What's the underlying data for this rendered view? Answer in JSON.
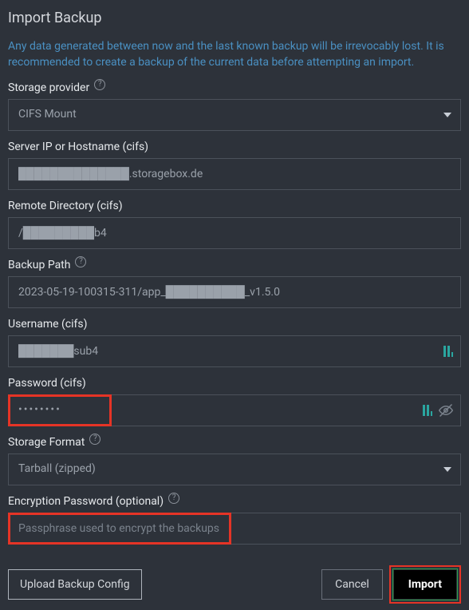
{
  "title": "Import Backup",
  "warning": "Any data generated between now and the last known backup will be irrevocably lost. It is recommended to create a backup of the current data before attempting an import.",
  "fields": {
    "storage_provider": {
      "label": "Storage provider",
      "value": "CIFS Mount"
    },
    "server_ip": {
      "label": "Server IP or Hostname (cifs)",
      "value": "██████████████.storagebox.de"
    },
    "remote_dir": {
      "label": "Remote Directory (cifs)",
      "value": "/█████████b4"
    },
    "backup_path": {
      "label": "Backup Path",
      "value": "2023-05-19-100315-311/app_██████████_v1.5.0"
    },
    "username": {
      "label": "Username (cifs)",
      "value": "███████sub4"
    },
    "password": {
      "label": "Password (cifs)",
      "value": "••••••••"
    },
    "storage_format": {
      "label": "Storage Format",
      "value": "Tarball (zipped)"
    },
    "encryption": {
      "label": "Encryption Password (optional)",
      "placeholder": "Passphrase used to encrypt the backups"
    }
  },
  "buttons": {
    "upload": "Upload Backup Config",
    "cancel": "Cancel",
    "import": "Import"
  }
}
